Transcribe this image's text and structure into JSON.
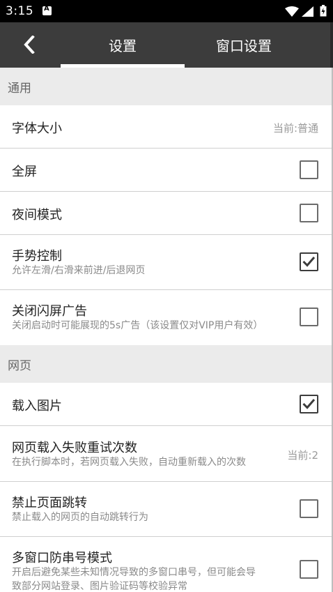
{
  "status_bar": {
    "time": "3:15"
  },
  "app_bar": {
    "tabs": [
      {
        "label": "设置",
        "selected": true
      },
      {
        "label": "窗口设置",
        "selected": false
      }
    ]
  },
  "sections": {
    "general": {
      "header": "通用"
    },
    "web": {
      "header": "网页"
    }
  },
  "settings": {
    "font_size": {
      "title": "字体大小",
      "value": "当前:普通"
    },
    "fullscreen": {
      "title": "全屏",
      "checked": false
    },
    "night_mode": {
      "title": "夜间模式",
      "checked": false
    },
    "gesture": {
      "title": "手势控制",
      "subtitle": "允许左滑/右滑来前进/后退网页",
      "checked": true
    },
    "splash_ad": {
      "title": "关闭闪屏广告",
      "subtitle": "关闭启动时可能展现的5s广告（该设置仅对VIP用户有效）",
      "checked": false
    },
    "load_images": {
      "title": "载入图片",
      "checked": true
    },
    "retry_count": {
      "title": "网页载入失败重试次数",
      "subtitle": "在执行脚本时，若网页载入失败，自动重新载入的次数",
      "value": "当前:2"
    },
    "no_redirect": {
      "title": "禁止页面跳转",
      "subtitle": "禁止载入的网页的自动跳转行为",
      "checked": false
    },
    "multi_window": {
      "title": "多窗口防串号模式",
      "subtitle_line1": "开启后避免某些未知情况导致的多窗口串号，但可能会导",
      "subtitle_line2": "致部分网站登录、图片验证码等校验异常",
      "checked": false
    }
  },
  "colors": {
    "app_bar": "#3c3c3c",
    "section_bg": "#ebebeb",
    "divider": "#cfcfcf"
  }
}
